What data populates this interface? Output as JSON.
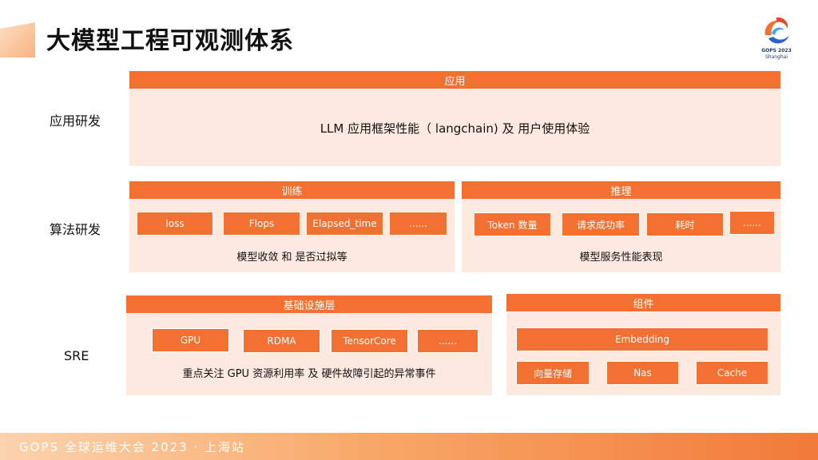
{
  "title": "大模型工程可观测体系",
  "logo": {
    "line1": "GOPS 2023",
    "line2": "Shanghai"
  },
  "rows": {
    "app": "应用研发",
    "algo": "算法研发",
    "sre": "SRE"
  },
  "application": {
    "header": "应用",
    "desc": "LLM 应用框架性能（ langchain) 及 用户使用体验"
  },
  "training": {
    "header": "训练",
    "chips": [
      "loss",
      "Flops",
      "Elapsed_time",
      "......"
    ],
    "desc": "模型收敛 和 是否过拟等"
  },
  "inference": {
    "header": "推理",
    "chips": [
      "Token 数量",
      "请求成功率",
      "耗时",
      "......"
    ],
    "desc": "模型服务性能表现"
  },
  "infra": {
    "header": "基础设施层",
    "chips": [
      "GPU",
      "RDMA",
      "TensorCore",
      "......"
    ],
    "desc": "重点关注 GPU 资源利用率 及 硬件故障引起的异常事件"
  },
  "components": {
    "header": "组件",
    "embedding": "Embedding",
    "chips": [
      "向量存储",
      "Nas",
      "Cache"
    ]
  },
  "footer": "GOPS 全球运维大会 2023 · 上海站",
  "colors": {
    "accent": "#f27132",
    "panel": "#fde9e0"
  }
}
